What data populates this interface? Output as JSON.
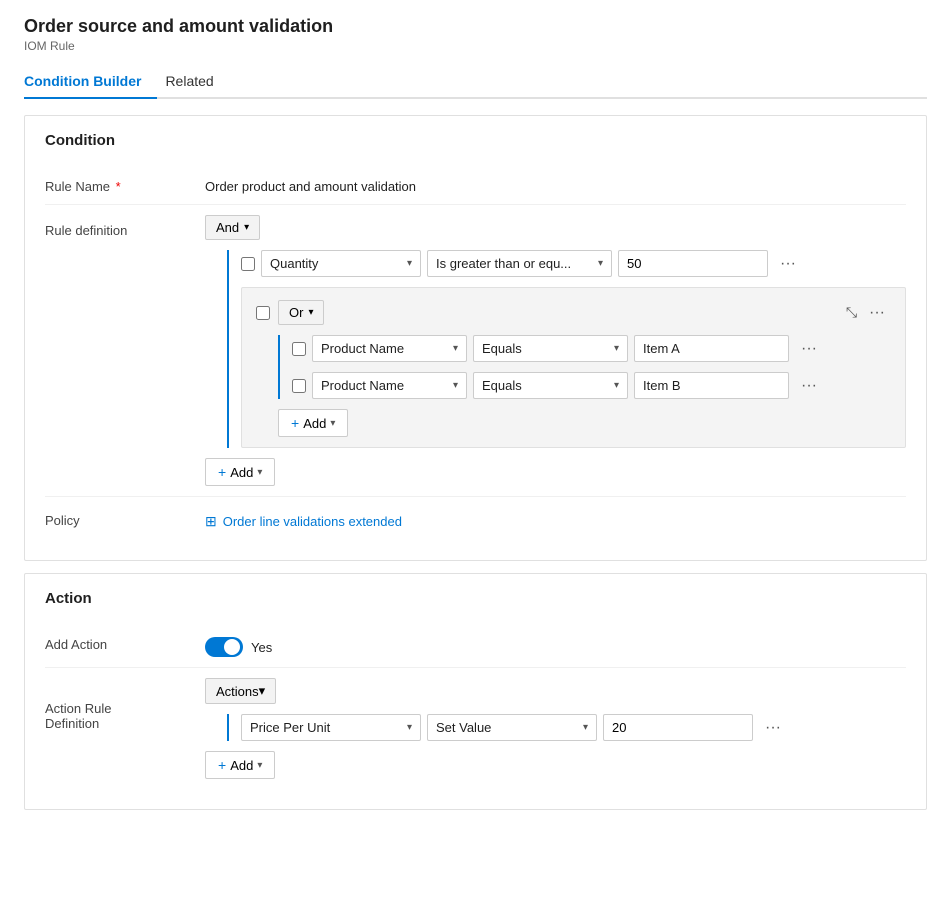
{
  "page": {
    "title": "Order source and amount validation",
    "subtitle": "IOM Rule"
  },
  "tabs": [
    {
      "id": "condition-builder",
      "label": "Condition Builder",
      "active": true
    },
    {
      "id": "related",
      "label": "Related",
      "active": false
    }
  ],
  "condition_section": {
    "title": "Condition",
    "rule_name_label": "Rule Name",
    "rule_name_value": "Order product and amount validation",
    "rule_definition_label": "Rule definition",
    "policy_label": "Policy",
    "policy_link_text": "Order line validations extended",
    "and_operator": "And",
    "or_operator": "Or",
    "quantity_field": "Quantity",
    "quantity_operator": "Is greater than or equ...",
    "quantity_value": "50",
    "product_name_field": "Product Name",
    "equals_operator": "Equals",
    "item_a_value": "Item A",
    "item_b_value": "Item B",
    "add_label": "Add",
    "add_label_outer": "Add"
  },
  "action_section": {
    "title": "Action",
    "add_action_label": "Add Action",
    "add_action_toggle": "Yes",
    "action_rule_definition_label": "Action Rule\nDefinition",
    "actions_operator": "Actions",
    "price_per_unit_field": "Price Per Unit",
    "set_value_operator": "Set Value",
    "value_20": "20",
    "add_label": "Add"
  },
  "icons": {
    "caret_down": "▾",
    "plus": "+",
    "dots": "···",
    "collapse": "⤡",
    "policy_icon": "⊞"
  }
}
